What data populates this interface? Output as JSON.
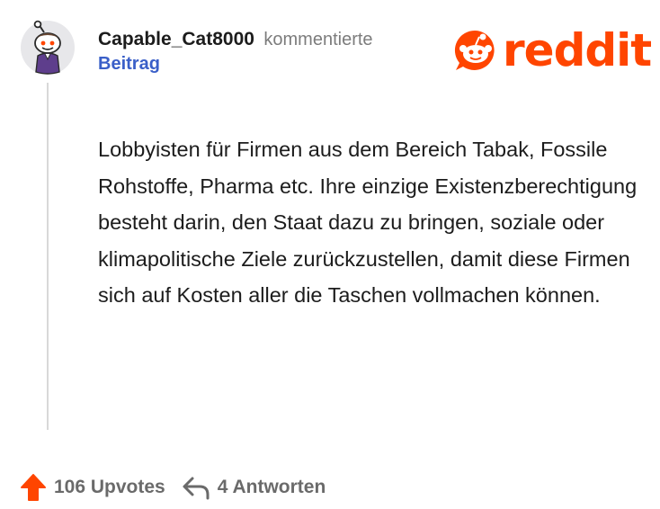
{
  "comment": {
    "username": "Capable_Cat8000",
    "action": "kommentierte",
    "link": "Beitrag",
    "text": "Lobbyisten für Firmen aus dem Bereich Tabak, Fossile Rohstoffe, Pharma etc. Ihre einzige Existenzberechtigung besteht darin, den Staat dazu zu bringen, soziale oder klimapolitische Ziele zurückzustellen, damit diese Firmen sich auf Kosten aller die Taschen vollmachen können."
  },
  "brand": {
    "wordmark": "reddit",
    "color": "#ff4500"
  },
  "footer": {
    "upvotes": "106 Upvotes",
    "answers": "4 Antworten"
  },
  "icons": {
    "avatar": "snoo-avatar-icon",
    "brand": "reddit-snoo-icon",
    "upvote": "upvote-arrow-icon",
    "reply": "reply-arrow-icon"
  }
}
